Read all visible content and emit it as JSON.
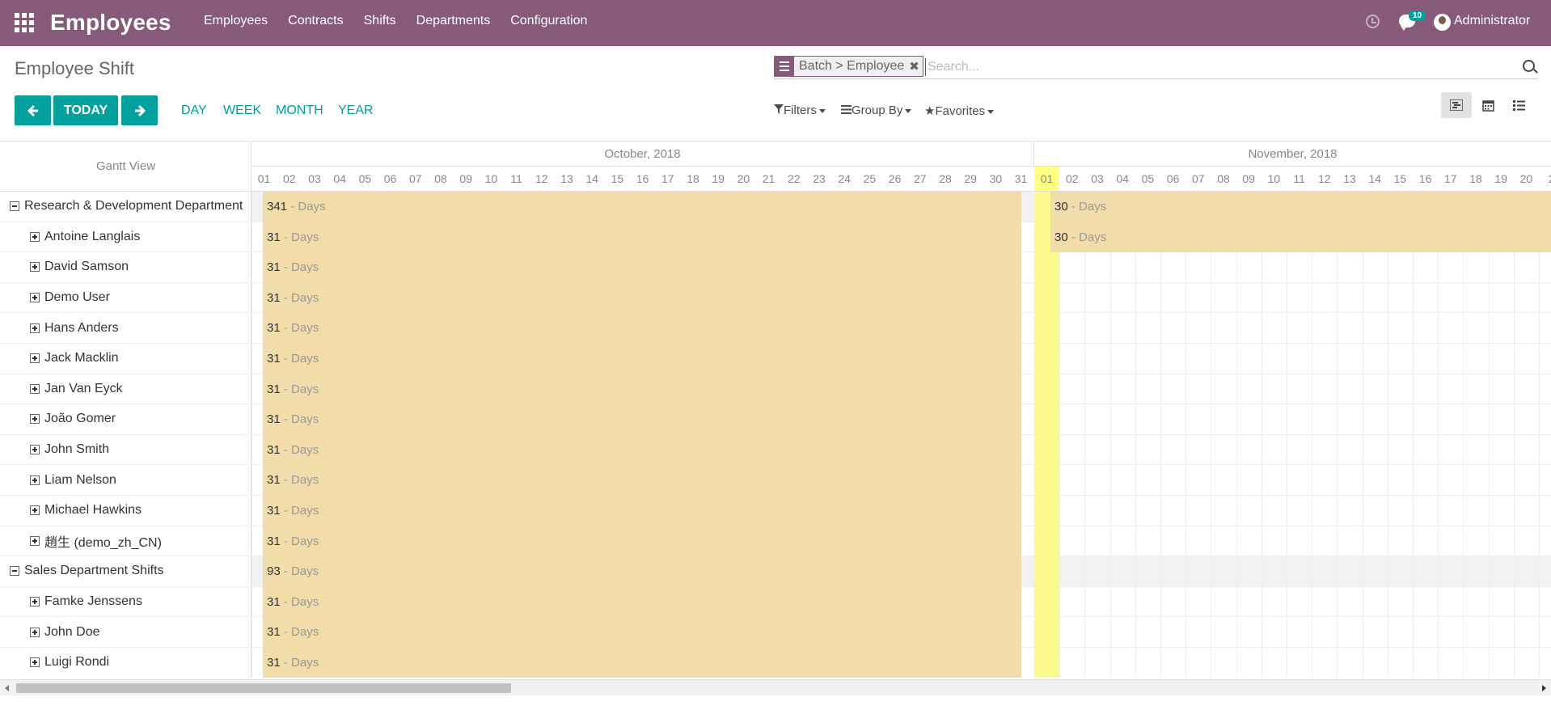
{
  "navbar": {
    "app_name": "Employees",
    "menu": [
      "Employees",
      "Contracts",
      "Shifts",
      "Departments",
      "Configuration"
    ],
    "badge_count": "10",
    "user": "Administrator"
  },
  "control": {
    "title": "Employee Shift",
    "facet": "Batch > Employee",
    "search_placeholder": "Search...",
    "today": "TODAY",
    "scales": [
      "DAY",
      "WEEK",
      "MONTH",
      "YEAR"
    ],
    "filters": "Filters",
    "group_by": "Group By",
    "favorites": "Favorites"
  },
  "gantt": {
    "title": "Gantt View",
    "months": [
      "October, 2018",
      "November, 2018"
    ],
    "oct_days": [
      "01",
      "02",
      "03",
      "04",
      "05",
      "06",
      "07",
      "08",
      "09",
      "10",
      "11",
      "12",
      "13",
      "14",
      "15",
      "16",
      "17",
      "18",
      "19",
      "20",
      "21",
      "22",
      "23",
      "24",
      "25",
      "26",
      "27",
      "28",
      "29",
      "30",
      "31"
    ],
    "nov_days": [
      "01",
      "02",
      "03",
      "04",
      "05",
      "06",
      "07",
      "08",
      "09",
      "10",
      "11",
      "12",
      "13",
      "14",
      "15",
      "16",
      "17",
      "18",
      "19",
      "20",
      "2"
    ],
    "unit": "- Days",
    "rows": [
      {
        "label": "Research & Development Department",
        "group": true,
        "oct": "341",
        "nov": "30"
      },
      {
        "label": "Antoine Langlais",
        "group": false,
        "oct": "31",
        "nov": "30"
      },
      {
        "label": "David Samson",
        "group": false,
        "oct": "31",
        "nov": ""
      },
      {
        "label": "Demo User",
        "group": false,
        "oct": "31",
        "nov": ""
      },
      {
        "label": "Hans Anders",
        "group": false,
        "oct": "31",
        "nov": ""
      },
      {
        "label": "Jack Macklin",
        "group": false,
        "oct": "31",
        "nov": ""
      },
      {
        "label": "Jan Van Eyck",
        "group": false,
        "oct": "31",
        "nov": ""
      },
      {
        "label": "João Gomer",
        "group": false,
        "oct": "31",
        "nov": ""
      },
      {
        "label": "John Smith",
        "group": false,
        "oct": "31",
        "nov": ""
      },
      {
        "label": "Liam Nelson",
        "group": false,
        "oct": "31",
        "nov": ""
      },
      {
        "label": "Michael Hawkins",
        "group": false,
        "oct": "31",
        "nov": ""
      },
      {
        "label": "趙生 (demo_zh_CN)",
        "group": false,
        "oct": "31",
        "nov": ""
      },
      {
        "label": "Sales Department Shifts",
        "group": true,
        "oct": "93",
        "nov": ""
      },
      {
        "label": "Famke Jenssens",
        "group": false,
        "oct": "31",
        "nov": ""
      },
      {
        "label": "John Doe",
        "group": false,
        "oct": "31",
        "nov": ""
      },
      {
        "label": "Luigi Rondi",
        "group": false,
        "oct": "31",
        "nov": ""
      }
    ]
  },
  "colors": {
    "brand": "#875a7b",
    "accent": "#00a09d",
    "bar": "#f2dcaa",
    "today": "#fdfa8c"
  }
}
